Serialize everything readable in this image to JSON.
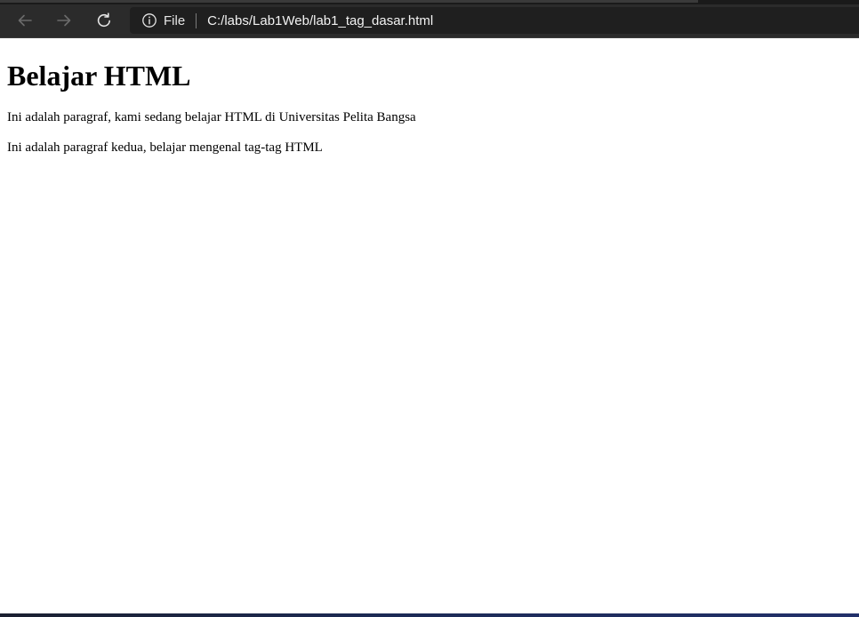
{
  "browser": {
    "back_icon": "arrow-left-icon",
    "forward_icon": "arrow-right-icon",
    "reload_icon": "reload-icon",
    "info_icon": "info-circle-icon",
    "scheme_label": "File",
    "url": "C:/labs/Lab1Web/lab1_tag_dasar.html"
  },
  "page": {
    "heading": "Belajar HTML",
    "paragraphs": [
      "Ini adalah paragraf, kami sedang belajar HTML di Universitas Pelita Bangsa",
      "Ini adalah paragraf kedua, belajar mengenal tag-tag HTML"
    ]
  },
  "colors": {
    "toolbar_bg": "#2b2b2b",
    "addressbar_bg": "#1f1f1f",
    "page_bg": "#ffffff",
    "text": "#000000"
  }
}
